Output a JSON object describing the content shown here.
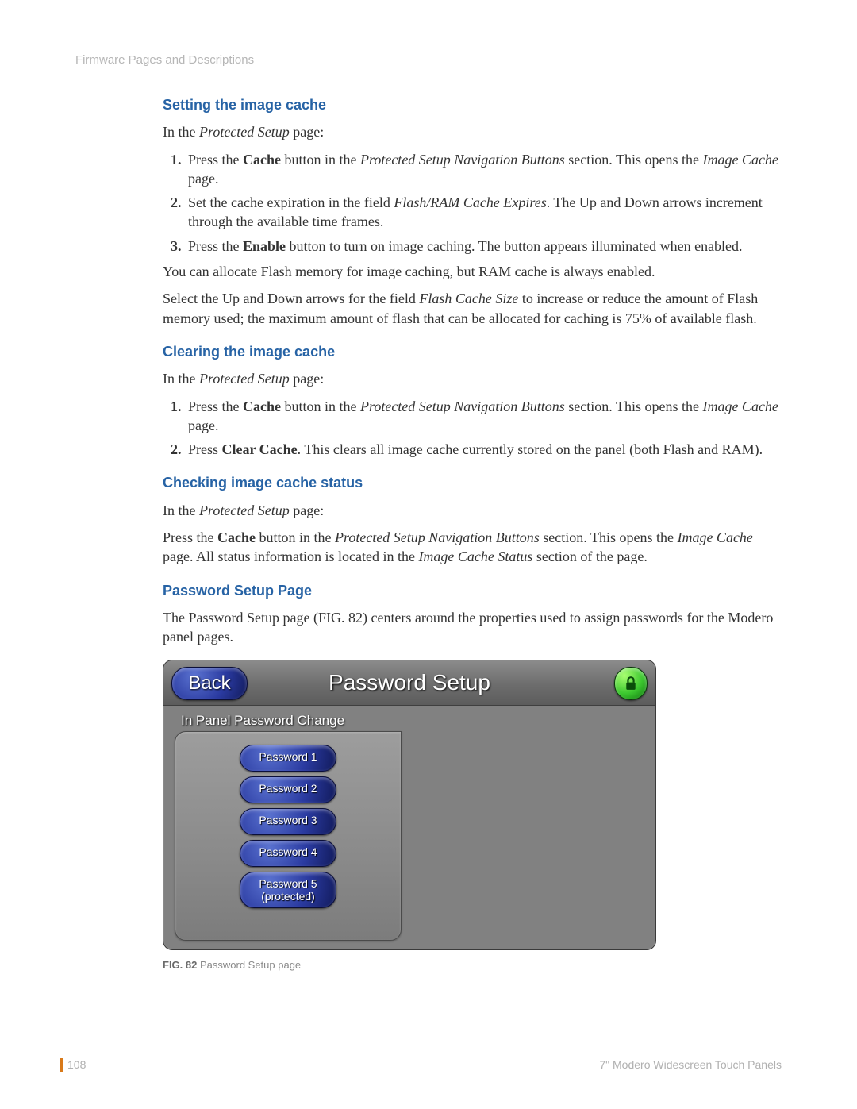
{
  "header": {
    "running": "Firmware Pages and Descriptions"
  },
  "sections": {
    "setting": {
      "title": "Setting the image cache",
      "intro_pre": "In the ",
      "intro_ital": "Protected Setup",
      "intro_post": " page:",
      "item1_a": "Press the ",
      "item1_b": "Cache",
      "item1_c": " button in the ",
      "item1_d": "Protected Setup Navigation Buttons",
      "item1_e": " section. This opens the ",
      "item1_f": "Image Cache",
      "item1_g": " page.",
      "item2_a": "Set the cache expiration in the field ",
      "item2_b": "Flash/RAM Cache Expires",
      "item2_c": ". The Up and Down arrows increment through the available time frames.",
      "item3_a": "Press the ",
      "item3_b": "Enable",
      "item3_c": " button to turn on image caching. The button appears illuminated when enabled.",
      "after1": "You can allocate Flash memory for image caching, but RAM cache is always enabled.",
      "after2_a": "Select the Up and Down arrows for the field ",
      "after2_b": "Flash Cache Size",
      "after2_c": " to increase or reduce the amount of Flash memory used; the maximum amount of flash that can be allocated for caching is 75% of available flash."
    },
    "clearing": {
      "title": "Clearing the image cache",
      "intro_pre": "In the ",
      "intro_ital": "Protected Setup",
      "intro_post": " page:",
      "item1_a": "Press the ",
      "item1_b": "Cache",
      "item1_c": " button in the ",
      "item1_d": "Protected Setup Navigation Buttons",
      "item1_e": " section. This opens the ",
      "item1_f": "Image Cache",
      "item1_g": " page.",
      "item2_a": "Press ",
      "item2_b": "Clear Cache",
      "item2_c": ". This clears all image cache currently stored on the panel (both Flash and RAM)."
    },
    "checking": {
      "title": "Checking image cache status",
      "intro_pre": "In the ",
      "intro_ital": "Protected Setup",
      "intro_post": " page:",
      "p_a": "Press the ",
      "p_b": "Cache",
      "p_c": " button in the ",
      "p_d": "Protected Setup Navigation Buttons",
      "p_e": " section. This opens the ",
      "p_f": "Image Cache",
      "p_g": " page. All status information is located in the ",
      "p_h": "Image Cache Status",
      "p_i": " section of the page."
    },
    "password": {
      "title": "Password Setup Page",
      "p": "The Password Setup page (FIG. 82) centers around the properties used to assign passwords for the Modero panel pages."
    }
  },
  "figure": {
    "back": "Back",
    "screen_title": "Password Setup",
    "tab": "In Panel Password Change",
    "buttons": [
      "Password 1",
      "Password 2",
      "Password 3",
      "Password 4"
    ],
    "protected_line1": "Password 5",
    "protected_line2": "(protected)",
    "caption_label": "FIG. 82",
    "caption_text": "  Password Setup page"
  },
  "footer": {
    "page": "108",
    "doc": "7\" Modero Widescreen Touch Panels"
  }
}
